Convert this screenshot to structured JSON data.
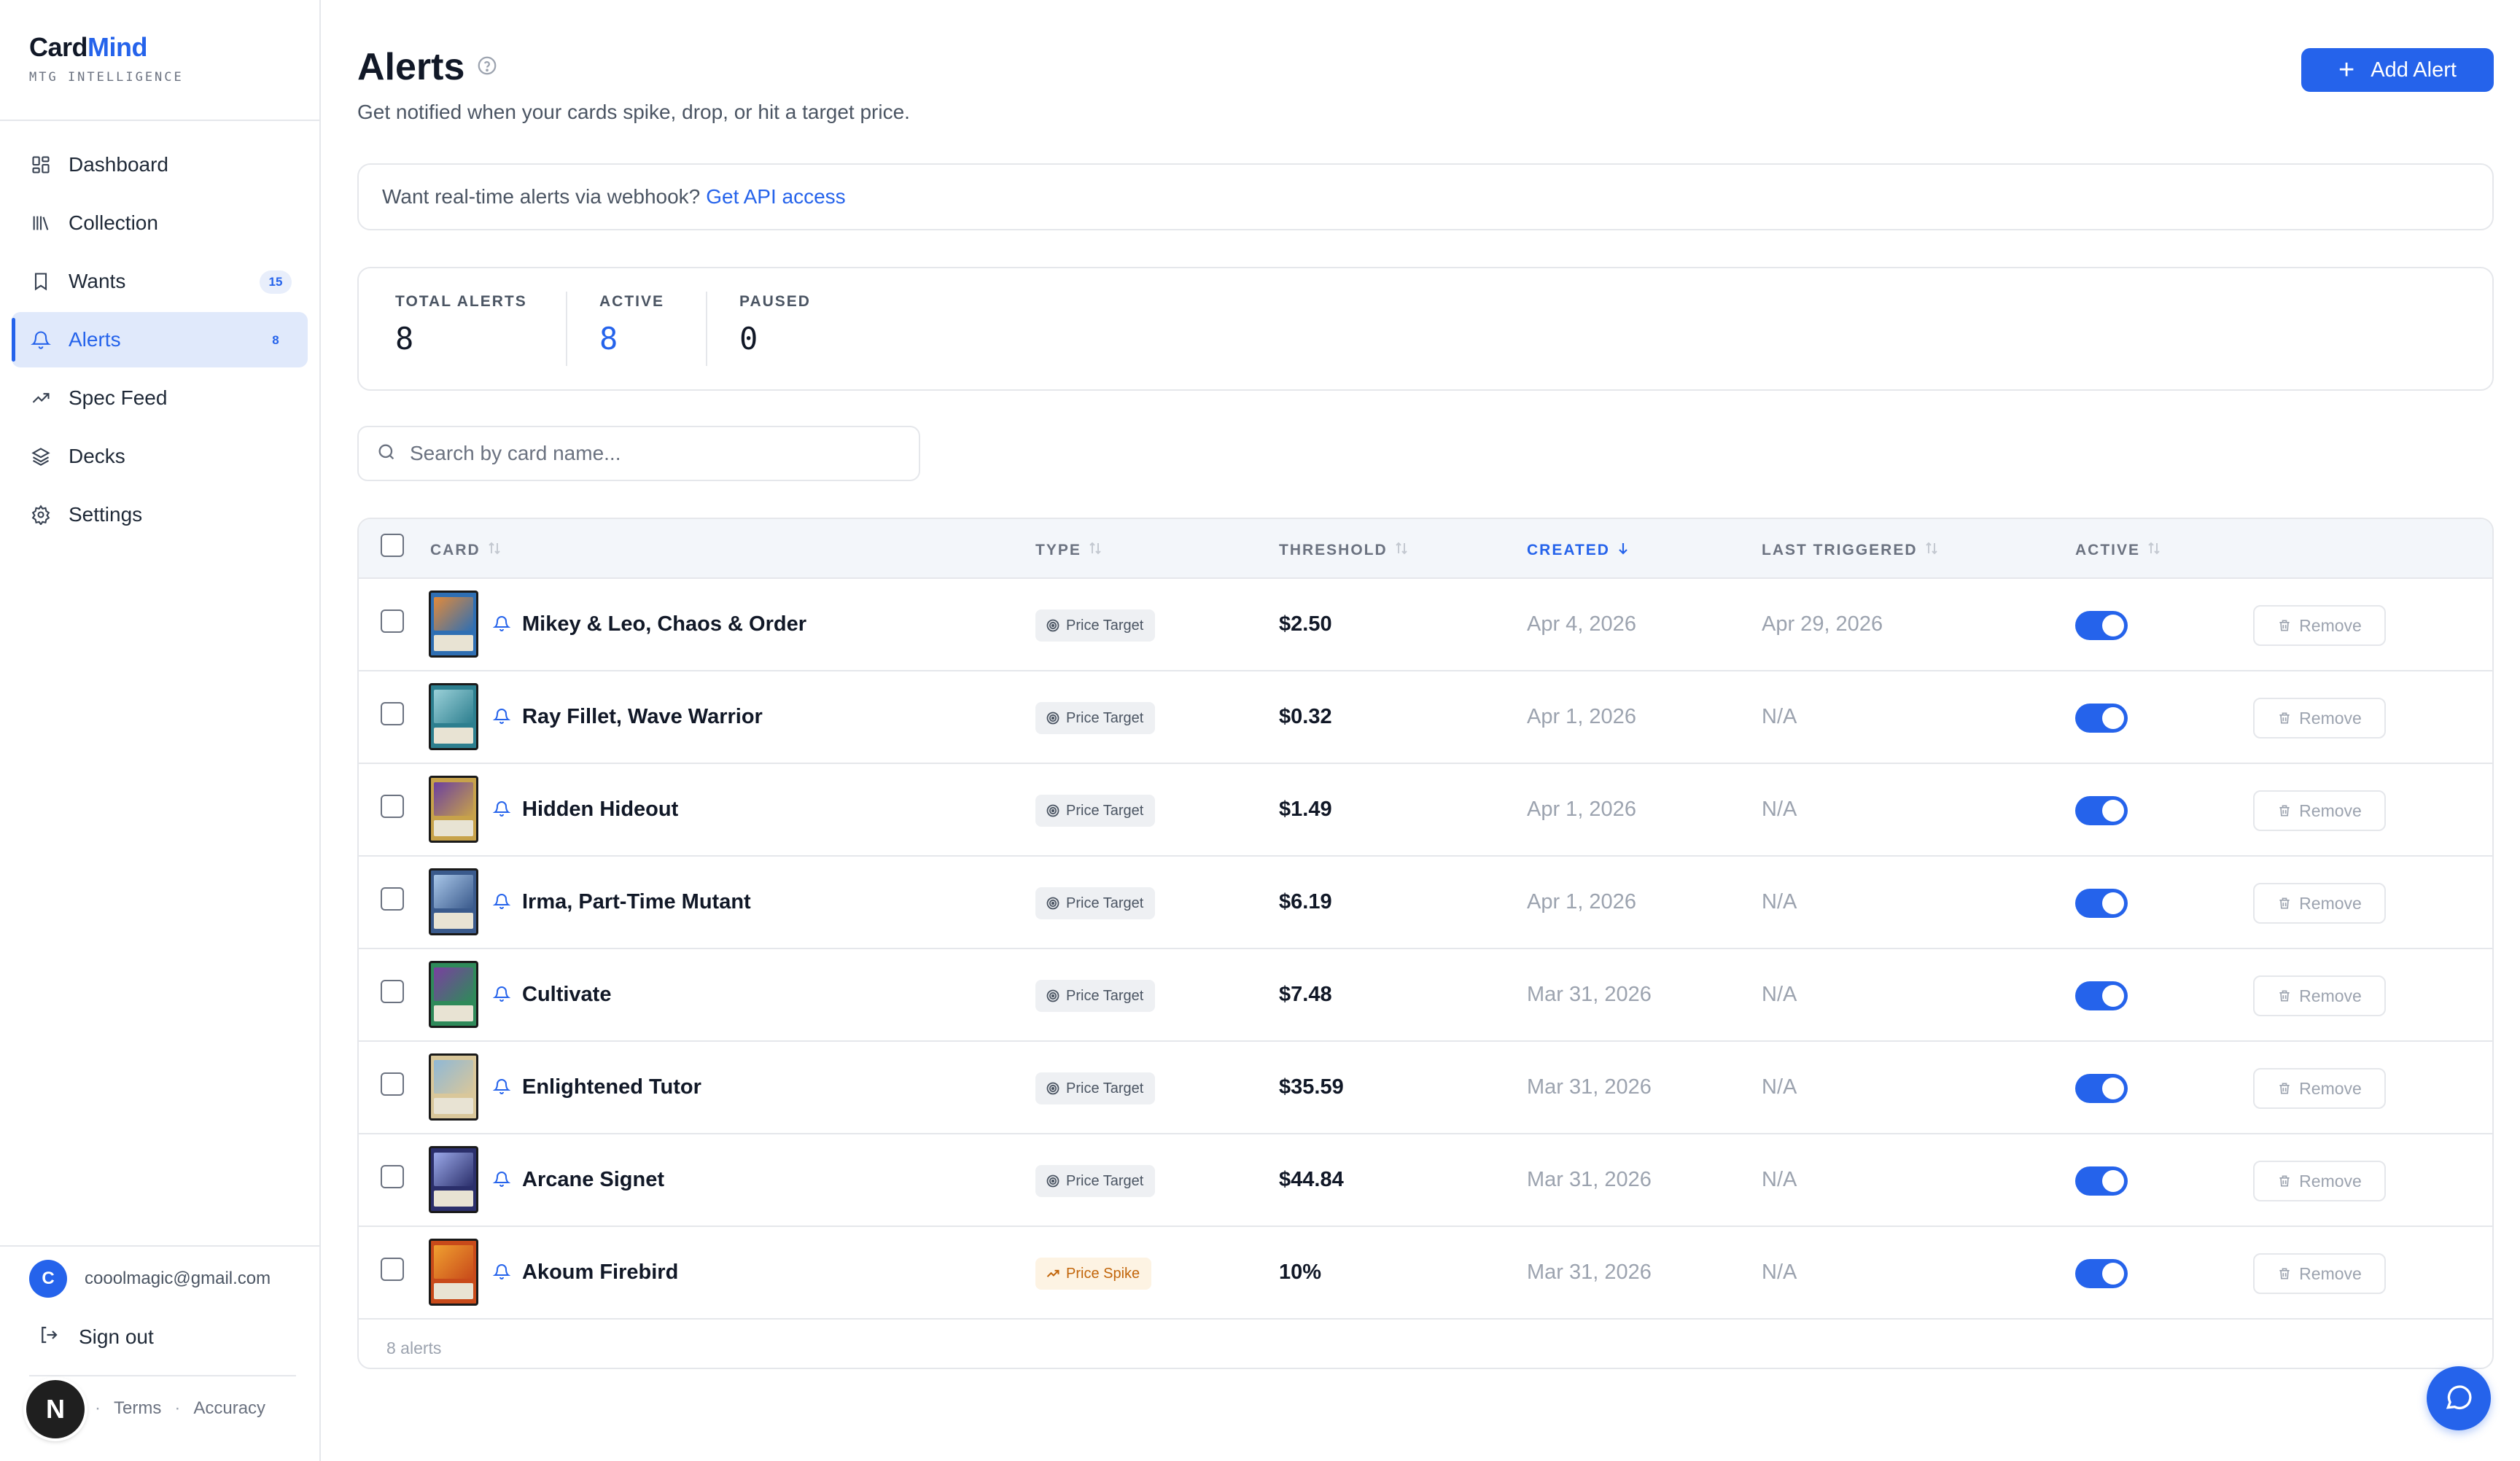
{
  "brand": {
    "name_part1": "Card",
    "name_part2": "Mind",
    "tagline": "MTG INTELLIGENCE"
  },
  "sidebar": {
    "items": [
      {
        "label": "Dashboard",
        "icon": "grid-icon",
        "badge": ""
      },
      {
        "label": "Collection",
        "icon": "library-icon",
        "badge": ""
      },
      {
        "label": "Wants",
        "icon": "bookmark-icon",
        "badge": "15"
      },
      {
        "label": "Alerts",
        "icon": "bell-icon",
        "badge": "8",
        "active": true
      },
      {
        "label": "Spec Feed",
        "icon": "trending-up-icon",
        "badge": ""
      },
      {
        "label": "Decks",
        "icon": "layers-icon",
        "badge": ""
      },
      {
        "label": "Settings",
        "icon": "gear-icon",
        "badge": ""
      }
    ],
    "user": {
      "initial": "C",
      "email": "cooolmagic@gmail.com"
    },
    "signout_label": "Sign out",
    "footer": {
      "privacy_partial": "y",
      "terms": "Terms",
      "accuracy": "Accuracy",
      "sep": "·"
    },
    "n_badge": "N"
  },
  "header": {
    "title": "Alerts",
    "subtitle": "Get notified when your cards spike, drop, or hit a target price.",
    "add_button_label": "Add Alert"
  },
  "api_banner": {
    "text": "Want real-time alerts via webhook?",
    "link": "Get API access"
  },
  "stats": [
    {
      "label": "TOTAL ALERTS",
      "value": "8"
    },
    {
      "label": "ACTIVE",
      "value": "8"
    },
    {
      "label": "PAUSED",
      "value": "0"
    }
  ],
  "search": {
    "placeholder": "Search by card name...",
    "value": ""
  },
  "table": {
    "columns": {
      "card": "CARD",
      "type": "TYPE",
      "threshold": "THRESHOLD",
      "created": "CREATED",
      "last_triggered": "LAST TRIGGERED",
      "active": "ACTIVE"
    },
    "sorted_column": "created",
    "remove_label": "Remove",
    "rows": [
      {
        "card": "Mikey & Leo, Chaos & Order",
        "type": "Price Target",
        "threshold": "$2.50",
        "created": "Apr 4, 2026",
        "last_triggered": "Apr 29, 2026",
        "active": true
      },
      {
        "card": "Ray Fillet, Wave Warrior",
        "type": "Price Target",
        "threshold": "$0.32",
        "created": "Apr 1, 2026",
        "last_triggered": "N/A",
        "active": true
      },
      {
        "card": "Hidden Hideout",
        "type": "Price Target",
        "threshold": "$1.49",
        "created": "Apr 1, 2026",
        "last_triggered": "N/A",
        "active": true
      },
      {
        "card": "Irma, Part-Time Mutant",
        "type": "Price Target",
        "threshold": "$6.19",
        "created": "Apr 1, 2026",
        "last_triggered": "N/A",
        "active": true
      },
      {
        "card": "Cultivate",
        "type": "Price Target",
        "threshold": "$7.48",
        "created": "Mar 31, 2026",
        "last_triggered": "N/A",
        "active": true
      },
      {
        "card": "Enlightened Tutor",
        "type": "Price Target",
        "threshold": "$35.59",
        "created": "Mar 31, 2026",
        "last_triggered": "N/A",
        "active": true
      },
      {
        "card": "Arcane Signet",
        "type": "Price Target",
        "threshold": "$44.84",
        "created": "Mar 31, 2026",
        "last_triggered": "N/A",
        "active": true
      },
      {
        "card": "Akoum Firebird",
        "type": "Price Spike",
        "threshold": "10%",
        "created": "Mar 31, 2026",
        "last_triggered": "N/A",
        "active": true
      }
    ],
    "footer_count": "8 alerts"
  },
  "colors": {
    "accent": "#2563eb",
    "spike": "#c2650a",
    "border": "#e5e7eb"
  }
}
